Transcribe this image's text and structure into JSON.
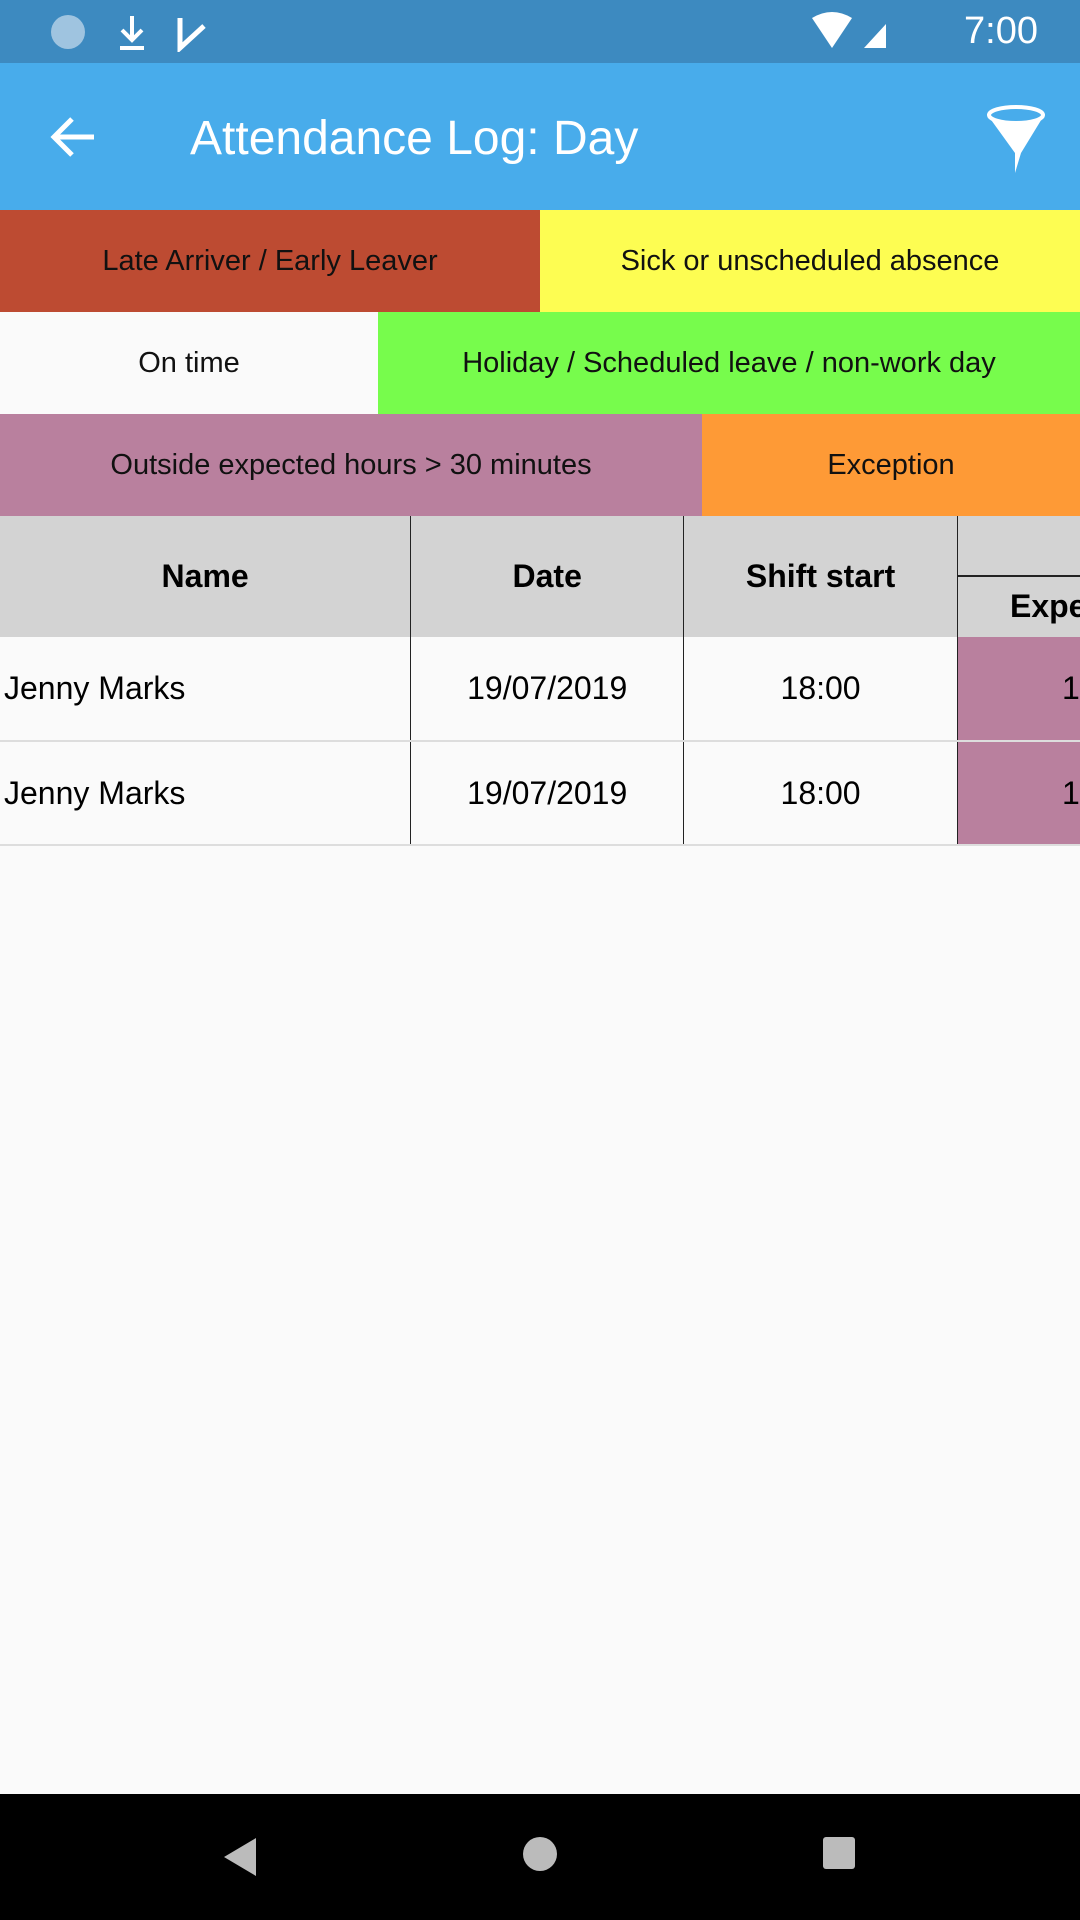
{
  "status_bar": {
    "time": "7:00",
    "icons": [
      "sync-icon",
      "download-icon",
      "task-icon",
      "wifi-icon",
      "signal-icon",
      "battery-charging-icon"
    ]
  },
  "app_bar": {
    "title": "Attendance Log: Day",
    "back_icon": "arrow-left-icon",
    "filter_icon": "funnel-icon"
  },
  "legend": [
    {
      "label": "Late Arriver / Early Leaver",
      "color": "#bd4b32"
    },
    {
      "label": "Sick or unscheduled absence",
      "color": "#fdfd52"
    },
    {
      "label": "On time",
      "color": "#fafafa"
    },
    {
      "label": "Holiday / Scheduled leave / non-work day",
      "color": "#77fc4c"
    },
    {
      "label": "Outside expected hours > 30 minutes",
      "color": "#b9809e"
    },
    {
      "label": "Exception",
      "color": "#fe9a36"
    }
  ],
  "table": {
    "headers": [
      "Name",
      "Date",
      "Shift start",
      "Expe"
    ],
    "rows": [
      {
        "name": "Jenny  Marks",
        "date": "19/07/2019",
        "shift_start": "18:00",
        "expected": "1"
      },
      {
        "name": "Jenny  Marks",
        "date": "19/07/2019",
        "shift_start": "18:00",
        "expected": "1"
      }
    ]
  }
}
